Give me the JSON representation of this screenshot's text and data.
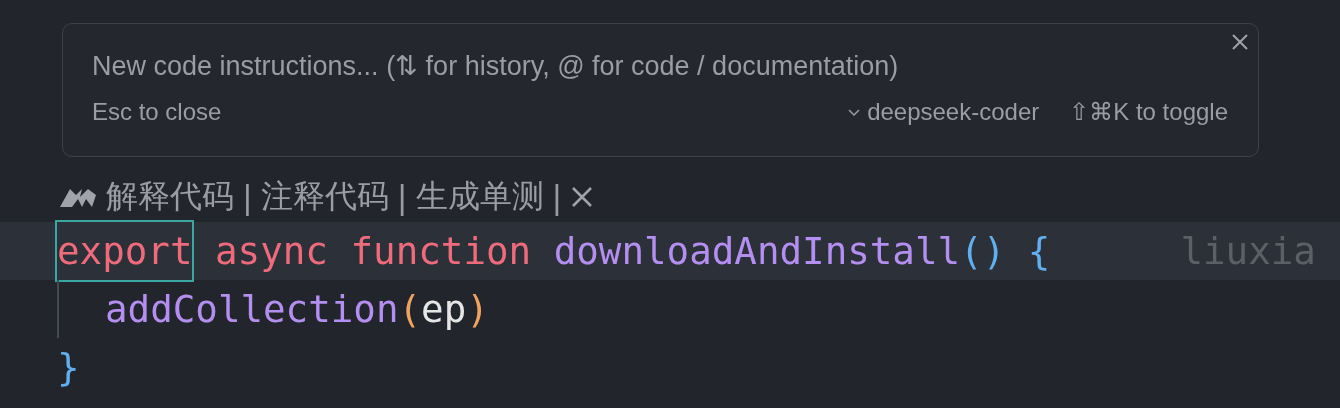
{
  "prompt_panel": {
    "placeholder": "New code instructions... (⇅ for history, @ for code / documentation)",
    "hint": "Esc to close",
    "model": "deepseek-coder",
    "toggle_hint": "⇧⌘K to toggle"
  },
  "codelens": [
    {
      "kind": "action",
      "text": "解释代码"
    },
    {
      "kind": "separator",
      "text": "|"
    },
    {
      "kind": "action",
      "text": "注释代码"
    },
    {
      "kind": "separator",
      "text": "|"
    },
    {
      "kind": "action",
      "text": "生成单测"
    },
    {
      "kind": "separator",
      "text": "|"
    },
    {
      "kind": "close"
    }
  ],
  "code_lines": [
    {
      "current": true,
      "indented": false,
      "blame": "liuxia",
      "tokens": [
        {
          "text": "export",
          "kind": "keyword",
          "outlined": true
        },
        {
          "text": " async",
          "kind": "keyword",
          "outlined": false
        },
        {
          "text": " function",
          "kind": "keyword",
          "outlined": false
        },
        {
          "text": " downloadAndInstall",
          "kind": "function",
          "outlined": false
        },
        {
          "text": "()",
          "kind": "bracket",
          "outlined": false
        },
        {
          "text": " {",
          "kind": "bracket",
          "outlined": false
        }
      ]
    },
    {
      "current": false,
      "indented": true,
      "tokens": [
        {
          "text": "addCollection",
          "kind": "function",
          "outlined": false
        },
        {
          "text": "(",
          "kind": "paren",
          "outlined": false
        },
        {
          "text": "ep",
          "kind": "plain",
          "outlined": false
        },
        {
          "text": ")",
          "kind": "paren",
          "outlined": false
        }
      ]
    },
    {
      "current": false,
      "indented": false,
      "tokens": [
        {
          "text": "}",
          "kind": "bracket",
          "outlined": false
        }
      ]
    }
  ]
}
